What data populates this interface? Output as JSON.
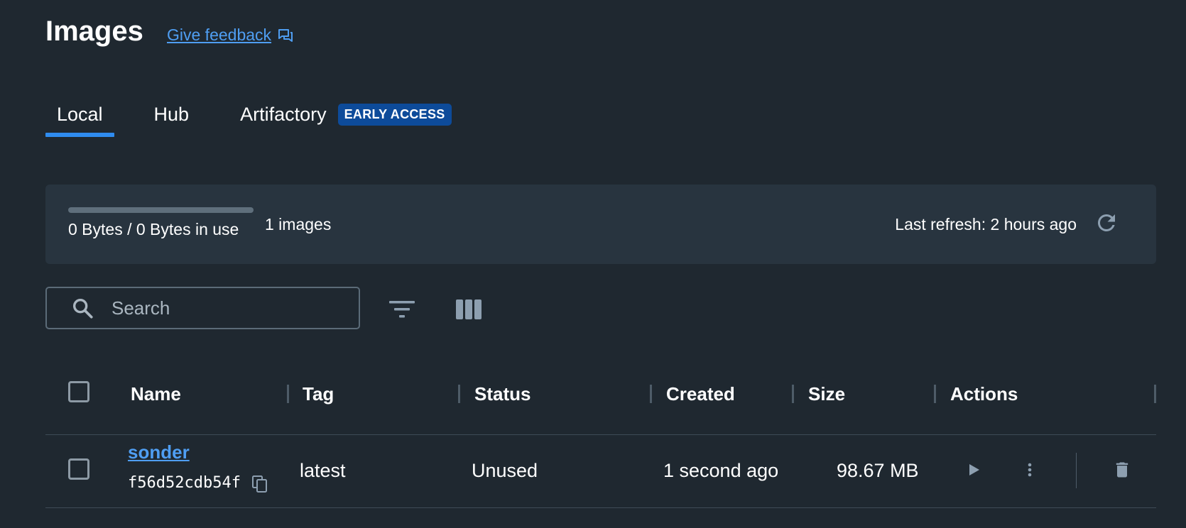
{
  "header": {
    "title": "Images",
    "feedback_label": "Give feedback"
  },
  "tabs": [
    {
      "label": "Local",
      "active": true
    },
    {
      "label": "Hub",
      "active": false
    },
    {
      "label": "Artifactory",
      "active": false,
      "badge": "EARLY ACCESS"
    }
  ],
  "summary": {
    "usage_text": "0 Bytes / 0 Bytes in use",
    "usage_fraction": 0,
    "images_count": "1 images",
    "last_refresh": "Last refresh: 2 hours ago"
  },
  "toolbar": {
    "search_placeholder": "Search",
    "filter_icon": "filter-icon",
    "columns_icon": "columns-icon"
  },
  "table": {
    "columns": [
      "Name",
      "Tag",
      "Status",
      "Created",
      "Size",
      "Actions"
    ],
    "rows": [
      {
        "name": "sonder",
        "id": "f56d52cdb54f",
        "tag": "latest",
        "status": "Unused",
        "created": "1 second ago",
        "size": "98.67 MB"
      }
    ]
  },
  "colors": {
    "background": "#1f2830",
    "panel": "#28343f",
    "accent": "#2f8cef",
    "link": "#4f9ef2",
    "badge": "#0d4b9a",
    "icon": "#8d9fb0"
  }
}
